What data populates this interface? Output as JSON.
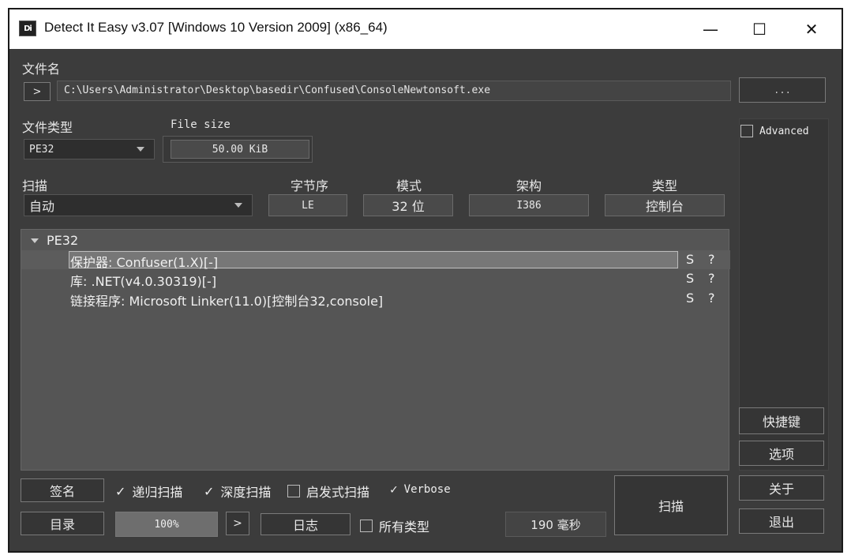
{
  "window": {
    "title": "Detect It Easy v3.07 [Windows 10 Version 2009] (x86_64)",
    "icon_text": "Di",
    "minimize": "—",
    "maximize": "☐",
    "close": "✕"
  },
  "file": {
    "label": "文件名",
    "expand": ">",
    "path": "C:\\Users\\Administrator\\Desktop\\basedir\\Confused\\ConsoleNewtonsoft.exe",
    "browse": "..."
  },
  "filetype": {
    "label": "文件类型",
    "value": "PE32"
  },
  "filesize": {
    "label": "File size",
    "value": "50.00 KiB"
  },
  "advanced": {
    "label": "Advanced"
  },
  "scan": {
    "label": "扫描",
    "mode_value": "自动"
  },
  "info": {
    "endian_label": "字节序",
    "endian": "LE",
    "mode_label": "模式",
    "mode": "32 位",
    "arch_label": "架构",
    "arch": "I386",
    "type_label": "类型",
    "type": "控制台"
  },
  "results": {
    "root": "PE32",
    "items": [
      {
        "text": "保护器: Confuser(1.X)[-]",
        "s": "S",
        "q": "?"
      },
      {
        "text": "库: .NET(v4.0.30319)[-]",
        "s": "S",
        "q": "?"
      },
      {
        "text": "链接程序: Microsoft Linker(11.0)[控制台32,console]",
        "s": "S",
        "q": "?"
      }
    ]
  },
  "side_buttons": {
    "shortcuts": "快捷键",
    "options": "选项",
    "about": "关于",
    "exit": "退出"
  },
  "bottom": {
    "signatures": "签名",
    "recursive": "递归扫描",
    "deep": "深度扫描",
    "heuristic": "启发式扫描",
    "verbose": "Verbose",
    "directory": "目录",
    "progress": "100%",
    "progress_fraction": 1.0,
    "next": ">",
    "log": "日志",
    "alltypes": "所有类型",
    "time": "190 毫秒",
    "scan_button": "扫描"
  }
}
